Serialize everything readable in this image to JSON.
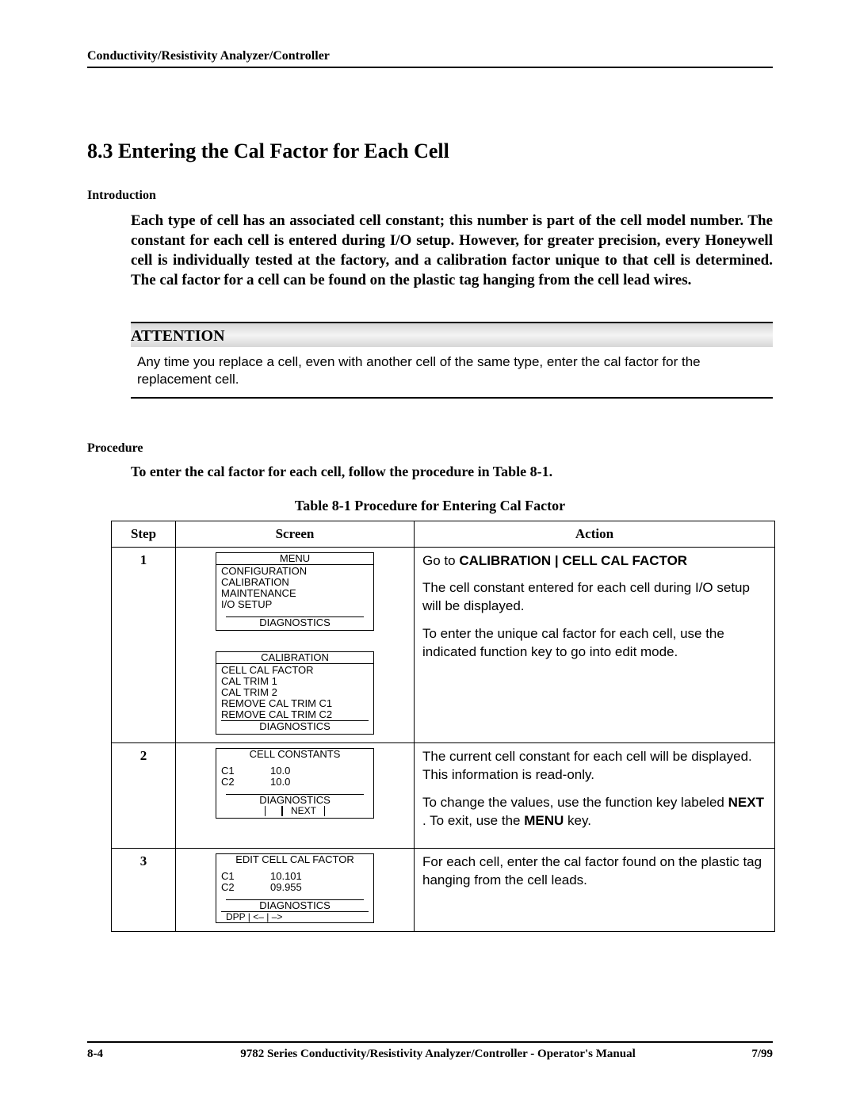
{
  "header": "Conductivity/Resistivity Analyzer/Controller",
  "section_title": "8.3  Entering the Cal Factor for Each Cell",
  "intro_heading": "Introduction",
  "intro_body": "Each type of cell has an associated cell constant; this number is part of the cell model number. The constant for each cell is entered during I/O setup.   However, for greater precision, every Honeywell cell is individually tested at the factory, and a calibration factor unique to that cell is determined.  The cal factor for a cell can be found on the plastic tag hanging from the cell lead wires.",
  "attention": {
    "label": "ATTENTION",
    "text": "Any time you replace a cell, even with another cell of the same type, enter the cal factor for the replacement cell."
  },
  "procedure": {
    "heading": "Procedure",
    "intro": "To enter the cal factor for each cell, follow the procedure in Table 8-1.",
    "caption": "Table 8-1  Procedure for Entering Cal Factor",
    "columns": {
      "step": "Step",
      "screen": "Screen",
      "action": "Action"
    },
    "rows": [
      {
        "step": "1",
        "screens": [
          {
            "title": "MENU",
            "lines": [
              "CONFIGURATION",
              "CALIBRATION",
              "MAINTENANCE",
              "I/O SETUP"
            ],
            "diag": "DIAGNOSTICS",
            "fkeys": [
              " ",
              " "
            ]
          },
          {
            "title": "CALIBRATION",
            "lines": [
              "CELL CAL FACTOR",
              "CAL TRIM 1",
              "CAL TRIM 2",
              "REMOVE CAL TRIM C1",
              "REMOVE CAL TRIM C2"
            ],
            "diag": "DIAGNOSTICS",
            "fkeys": [
              " ",
              " "
            ]
          }
        ],
        "action": {
          "p1a": "Go to ",
          "p1b": "CALIBRATION | CELL CAL FACTOR",
          "p2": "The cell constant entered for each cell during I/O setup will be displayed.",
          "p3": "To enter the unique cal factor for each cell, use the indicated function key to go into edit mode."
        }
      },
      {
        "step": "2",
        "screens": [
          {
            "title": "CELL CONSTANTS",
            "kv": [
              {
                "k": "C1",
                "v": "10.0"
              },
              {
                "k": "C2",
                "v": "10.0"
              }
            ],
            "diag": "DIAGNOSTICS",
            "fkeys": [
              " ",
              "NEXT"
            ]
          }
        ],
        "action": {
          "p1": "The current cell constant for each cell will be displayed. This information is read-only.",
          "p2a": "To change the values, use the function key labeled ",
          "p2b": "NEXT",
          "p2c": " .  To exit, use the ",
          "p2d": "MENU",
          "p2e": " key."
        }
      },
      {
        "step": "3",
        "screens": [
          {
            "title": "EDIT CELL CAL FACTOR",
            "kv": [
              {
                "k": "C1",
                "v": "10.101"
              },
              {
                "k": "C2",
                "v": "09.955"
              }
            ],
            "diag": "DIAGNOSTICS",
            "full_fkeys": "DPP   | <– | –>"
          }
        ],
        "action": {
          "p1": "For each cell, enter the cal factor found on the plastic tag hanging from the cell leads."
        }
      }
    ]
  },
  "footer": {
    "page": "8-4",
    "title": "9782 Series Conductivity/Resistivity Analyzer/Controller - Operator's Manual",
    "date": "7/99"
  }
}
